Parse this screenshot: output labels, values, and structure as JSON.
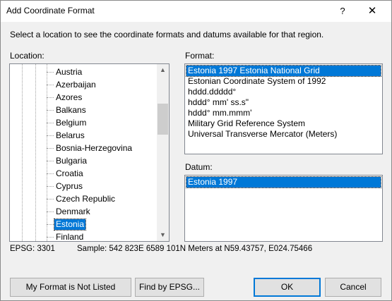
{
  "window": {
    "title": "Add Coordinate Format",
    "help_label": "?",
    "close_label": "✕"
  },
  "instructions": "Select a location to see the coordinate formats and datums available for that region.",
  "location": {
    "label": "Location:",
    "items": [
      "Austria",
      "Azerbaijan",
      "Azores",
      "Balkans",
      "Belgium",
      "Belarus",
      "Bosnia-Herzegovina",
      "Bulgaria",
      "Croatia",
      "Cyprus",
      "Czech Republic",
      "Denmark",
      "Estonia",
      "Finland"
    ],
    "selected": "Estonia",
    "scroll_up": "▲",
    "scroll_down": "▼"
  },
  "format": {
    "label": "Format:",
    "items": [
      "Estonia 1997 Estonia National Grid",
      "Estonian Coordinate System of 1992",
      "hddd.ddddd°",
      "hddd° mm' ss.s\"",
      "hddd° mm.mmm'",
      "Military Grid Reference System",
      "Universal Transverse Mercator (Meters)"
    ],
    "selected": "Estonia 1997 Estonia National Grid"
  },
  "datum": {
    "label": "Datum:",
    "items": [
      "Estonia 1997"
    ],
    "selected": "Estonia 1997"
  },
  "status": {
    "epsg": "EPSG: 3301",
    "sample": "Sample: 542 823E  6589 101N Meters at N59.43757, E024.75466"
  },
  "buttons": {
    "not_listed": "My Format is Not Listed",
    "find_epsg": "Find by EPSG...",
    "ok": "OK",
    "cancel": "Cancel"
  },
  "colors": {
    "selection": "#0078d7",
    "dialog_bg": "#f0f0f0"
  }
}
